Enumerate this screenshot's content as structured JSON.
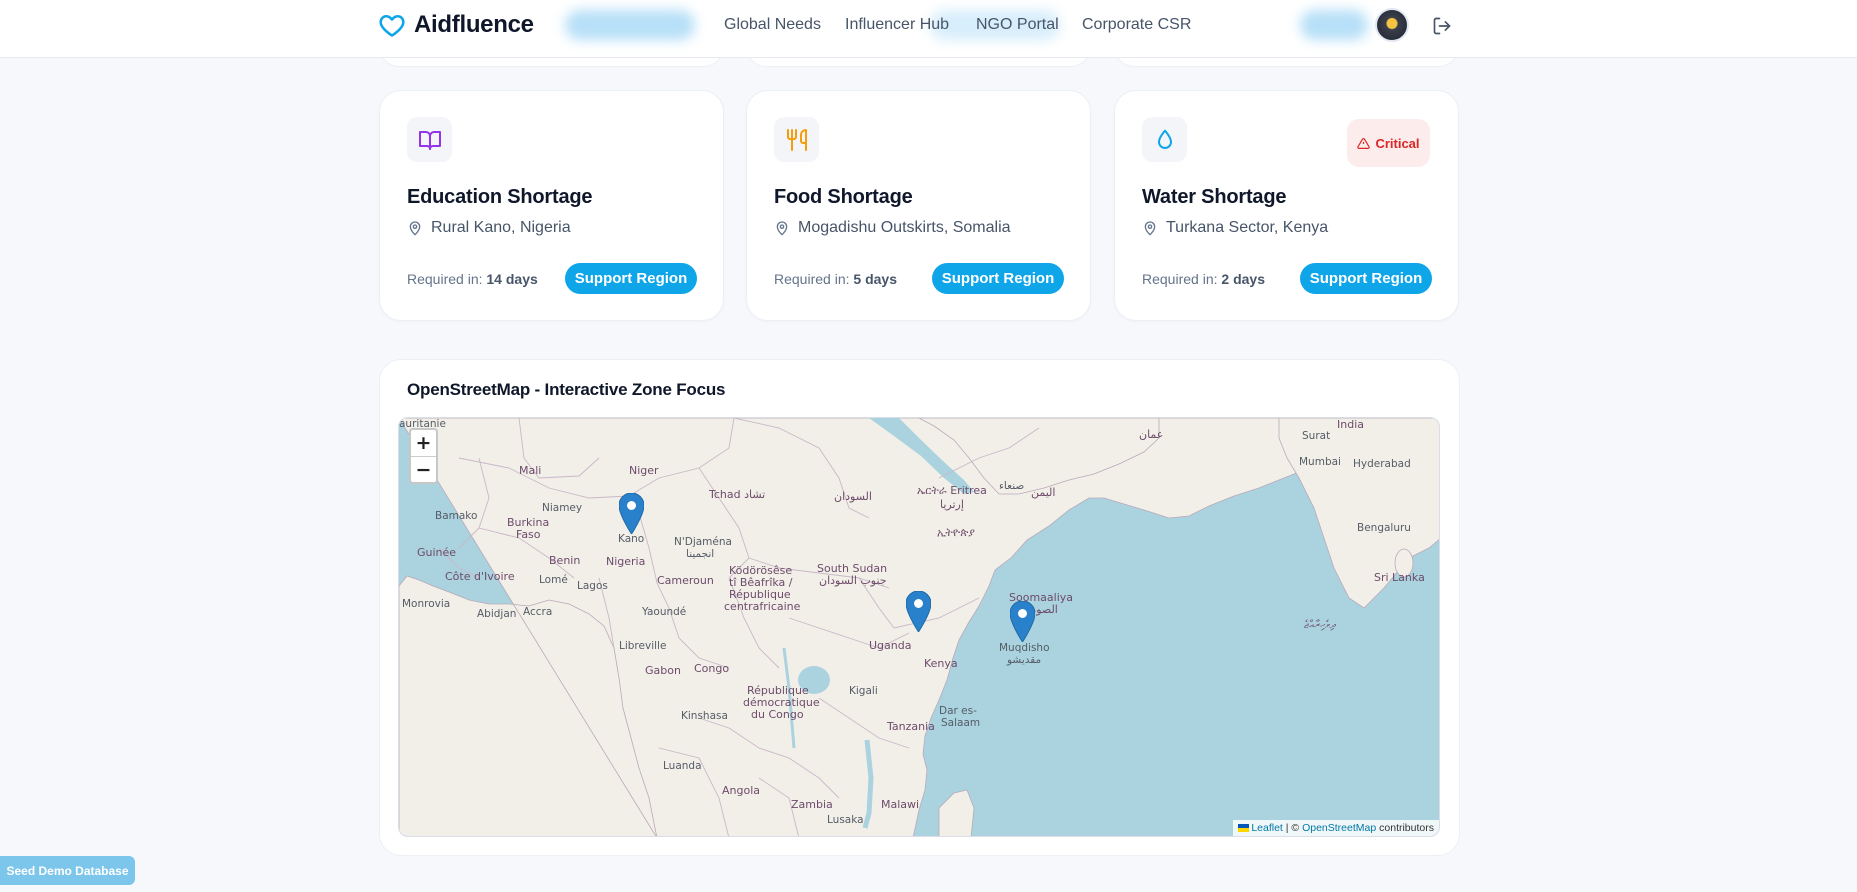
{
  "nav": {
    "brand": "Aidfluence",
    "links": [
      "Global Needs",
      "Influencer Hub",
      "NGO Portal",
      "Corporate CSR"
    ]
  },
  "cards": [
    {
      "icon": "book-icon",
      "title": "Education Shortage",
      "location": "Rural Kano, Nigeria",
      "required_label": "Required in:",
      "required_value": "14 days",
      "button": "Support Region",
      "accent": "#9333ea"
    },
    {
      "icon": "utensils-icon",
      "title": "Food Shortage",
      "location": "Mogadishu Outskirts, Somalia",
      "required_label": "Required in:",
      "required_value": "5 days",
      "button": "Support Region",
      "accent": "#f59e0b"
    },
    {
      "icon": "droplet-icon",
      "title": "Water Shortage",
      "location": "Turkana Sector, Kenya",
      "required_label": "Required in:",
      "required_value": "2 days",
      "button": "Support Region",
      "badge": "Critical",
      "accent": "#0ea5e9"
    }
  ],
  "map_section": {
    "title": "OpenStreetMap - Interactive Zone Focus",
    "zoom_in": "+",
    "zoom_out": "−",
    "attribution_leaflet": "Leaflet",
    "attribution_sep": " | © ",
    "attribution_osm": "OpenStreetMap",
    "attribution_tail": " contributors",
    "labels": {
      "mauritanie": "auritanie",
      "mali": "Mali",
      "niger": "Niger",
      "tchad": "Tchad تشاد",
      "sudan": "السودان",
      "eritrea": "ኤርትራ Eritrea",
      "eritrea_ar": "إرتريا",
      "yemen": "اليمن",
      "sanaa": "صنعاء",
      "oman": "عمان",
      "india": "India",
      "surat": "Surat",
      "mumbai": "Mumbai",
      "hyderabad": "Hyderabad",
      "bengaluru": "Bengaluru",
      "srilanka": "Sri Lanka",
      "maldives": "ދިވެހިރާއްޖެ",
      "bamako": "Bamako",
      "niamey": "Niamey",
      "burkina": "Burkina",
      "faso": "Faso",
      "kano": "Kano",
      "ndjamena": "N'Djaména",
      "ndjamena_ar": "انجمينا",
      "ethiopia": "ኢትዮጵያ",
      "guinee": "Guinée",
      "benin": "Benin",
      "nigeria": "Nigeria",
      "cotedivoire": "Côte d'Ivoire",
      "lome": "Lomé",
      "lagos": "Lagos",
      "cameroun": "Cameroun",
      "kodoroese": "Ködörösêse",
      "tibeafrika": "tî Bêafrîka /",
      "republique": "République",
      "centrafricaine": "centrafricaine",
      "southsudan": "South Sudan",
      "southsudan_ar": "جنوب السودان",
      "somaliya": "Soomaaliya",
      "somaliya_ar": "الصومال",
      "monrovia": "Monrovia",
      "abidjan": "Abidjan",
      "accra": "Accra",
      "yaounde": "Yaoundé",
      "mogadishu": "Muqdisho",
      "mogadishu_ar": "مقديشو",
      "libreville": "Libreville",
      "gabon": "Gabon",
      "congo": "Congo",
      "uganda": "Uganda",
      "kenya": "Kenya",
      "kigali": "Kigali",
      "rdc1": "République",
      "rdc2": "démocratique",
      "rdc3": "du Congo",
      "kinshasa": "Kinshasa",
      "dar": "Dar es-",
      "salaam": "Salaam",
      "tanzania": "Tanzania",
      "luanda": "Luanda",
      "angola": "Angola",
      "zambia": "Zambia",
      "malawi": "Malawi",
      "lusaka": "Lusaka"
    }
  },
  "seed_button": "Seed Demo Database"
}
